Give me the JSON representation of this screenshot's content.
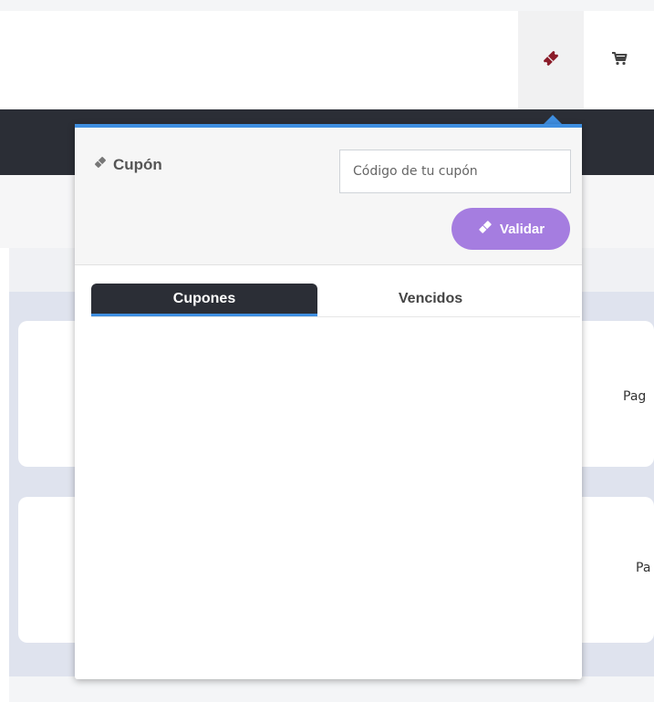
{
  "header": {
    "coupon_icon": "coupon-ticket-icon",
    "cart_icon": "cart-icon",
    "coupon_icon_color": "#8b1c2a"
  },
  "cards": [
    {
      "text": "Pag"
    },
    {
      "text": "Pa"
    }
  ],
  "coupon_popover": {
    "title": "Cupón",
    "title_icon": "ticket-icon",
    "code_input": {
      "placeholder": "Código de tu cupón",
      "value": ""
    },
    "validate_button": {
      "label": "Validar",
      "icon": "ticket-icon"
    },
    "tabs": [
      {
        "label": "Cupones",
        "active": true
      },
      {
        "label": "Vencidos",
        "active": false
      }
    ]
  },
  "colors": {
    "accent_blue": "#3e8ee0",
    "dark_nav": "#2b2e36",
    "validate_purple": "#a57de0"
  }
}
